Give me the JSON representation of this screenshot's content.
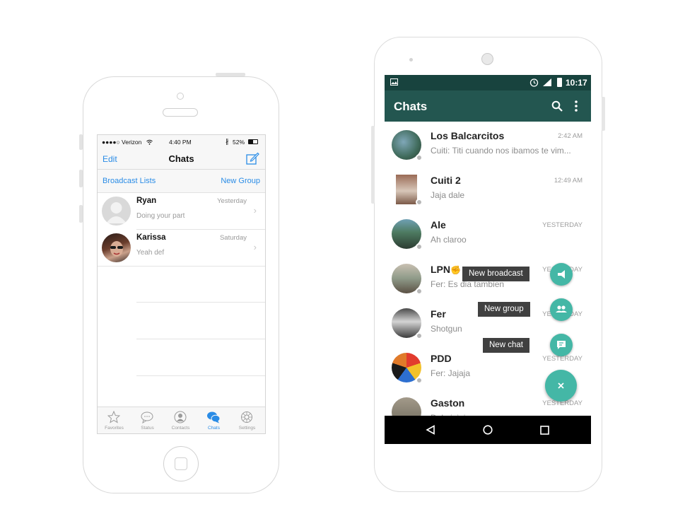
{
  "ios": {
    "status": {
      "carrier": "●●●●○ Verizon",
      "time": "4:40 PM",
      "battery": "52%"
    },
    "nav": {
      "edit_label": "Edit",
      "title": "Chats"
    },
    "subbar": {
      "broadcast_label": "Broadcast Lists",
      "new_group_label": "New Group"
    },
    "chats": [
      {
        "name": "Ryan",
        "message": "Doing your part",
        "time": "Yesterday"
      },
      {
        "name": "Karissa",
        "message": "Yeah def",
        "time": "Saturday"
      }
    ],
    "tabs": [
      {
        "label": "Favorites",
        "icon": "star-icon"
      },
      {
        "label": "Status",
        "icon": "speech-bubble-icon"
      },
      {
        "label": "Contacts",
        "icon": "person-icon"
      },
      {
        "label": "Chats",
        "icon": "chat-bubbles-icon"
      },
      {
        "label": "Settings",
        "icon": "gear-icon"
      }
    ],
    "colors": {
      "accent": "#2a8ce6",
      "muted": "#9a9a9a"
    }
  },
  "android": {
    "status": {
      "time": "10:17"
    },
    "appbar": {
      "title": "Chats"
    },
    "chats": [
      {
        "name": "Los Balcarcitos",
        "message": "Cuiti: Titi cuando nos ibamos te vim...",
        "time": "2:42 AM"
      },
      {
        "name": "Cuiti 2",
        "message": "Jaja dale",
        "time": "12:49 AM"
      },
      {
        "name": "Ale",
        "message": "Ah claroo",
        "time": "YESTERDAY"
      },
      {
        "name": "LPN",
        "message": "Fer: Es dia tambien",
        "time": "YESTERDAY"
      },
      {
        "name": "Fer",
        "message": "Shotgun",
        "time": "YESTERDAY"
      },
      {
        "name": "PDD",
        "message": "Fer: Jajaja",
        "time": "YESTERDAY"
      },
      {
        "name": "Gaston",
        "message": "Dale jajaja",
        "time": "YESTERDAY"
      }
    ],
    "fab_menu": {
      "broadcast_label": "New broadcast",
      "group_label": "New group",
      "chat_label": "New chat"
    },
    "colors": {
      "status_bar": "#18433e",
      "app_bar": "#235650",
      "fab": "#44b7a6"
    }
  }
}
